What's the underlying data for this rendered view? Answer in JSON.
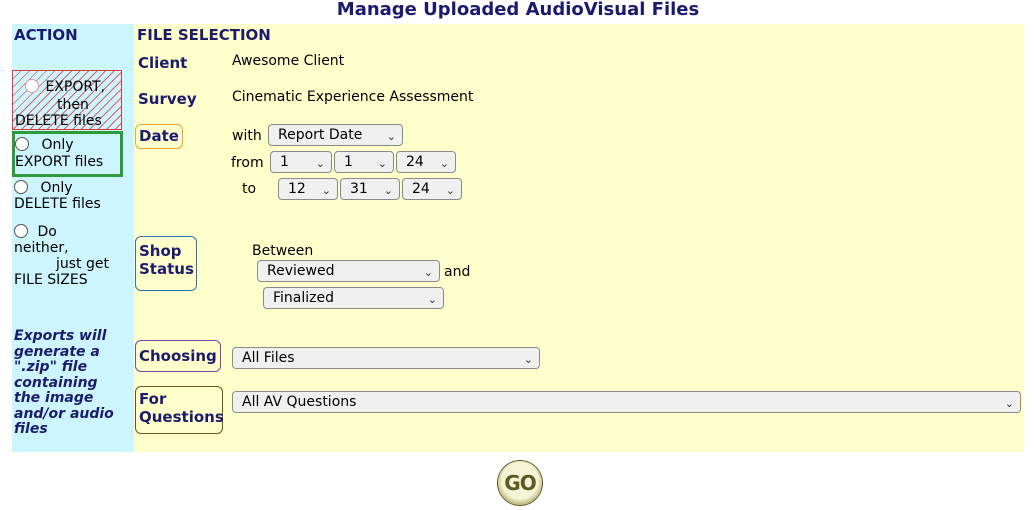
{
  "page": {
    "title": "Manage Uploaded AudioVisual Files"
  },
  "action": {
    "header": "ACTION",
    "options": [
      {
        "line1": "EXPORT,",
        "line2": "then",
        "line3": "DELETE files"
      },
      {
        "line1": "Only",
        "line2": "EXPORT files"
      },
      {
        "line1": "Only",
        "line2": "DELETE files"
      },
      {
        "line1": "Do",
        "line2": "neither,",
        "line3": "just get",
        "line4": "FILE SIZES"
      }
    ],
    "note": {
      "l1": "Exports will",
      "l2": "generate a",
      "l3": "\".zip\" file",
      "l4": "containing",
      "l5": "the image",
      "l6": "and/or audio",
      "l7": "files"
    }
  },
  "selection": {
    "header": "FILE SELECTION",
    "client": {
      "label": "Client",
      "value": "Awesome Client"
    },
    "survey": {
      "label": "Survey",
      "value": "Cinematic Experience Assessment"
    },
    "date": {
      "label": "Date",
      "with_text": "with",
      "from_text": "from",
      "to_text": "to",
      "field": "Report Date",
      "from": {
        "month": "1",
        "day": "1",
        "year": "24"
      },
      "to": {
        "month": "12",
        "day": "31",
        "year": "24"
      }
    },
    "shop_status": {
      "label_l1": "Shop",
      "label_l2": "Status",
      "between_text": "Between",
      "and_text": "and",
      "from": "Reviewed",
      "to": "Finalized"
    },
    "choosing": {
      "label": "Choosing",
      "value": "All Files"
    },
    "questions": {
      "label_l1": "For",
      "label_l2": "Questions",
      "value": "All AV Questions"
    }
  },
  "go": {
    "label": "GO"
  },
  "colors": {
    "action_bg": "#ccf5ff",
    "selection_bg": "#ffffcc",
    "title": "#1b1b6e",
    "date_tag": "#e8a33c",
    "shop_tag": "#2f6fb3",
    "choosing_tag": "#8b3fa8",
    "questions_tag": "#6b5420",
    "export_delete_box": "#d93b3b",
    "export_only_box": "#2e9a3a"
  }
}
